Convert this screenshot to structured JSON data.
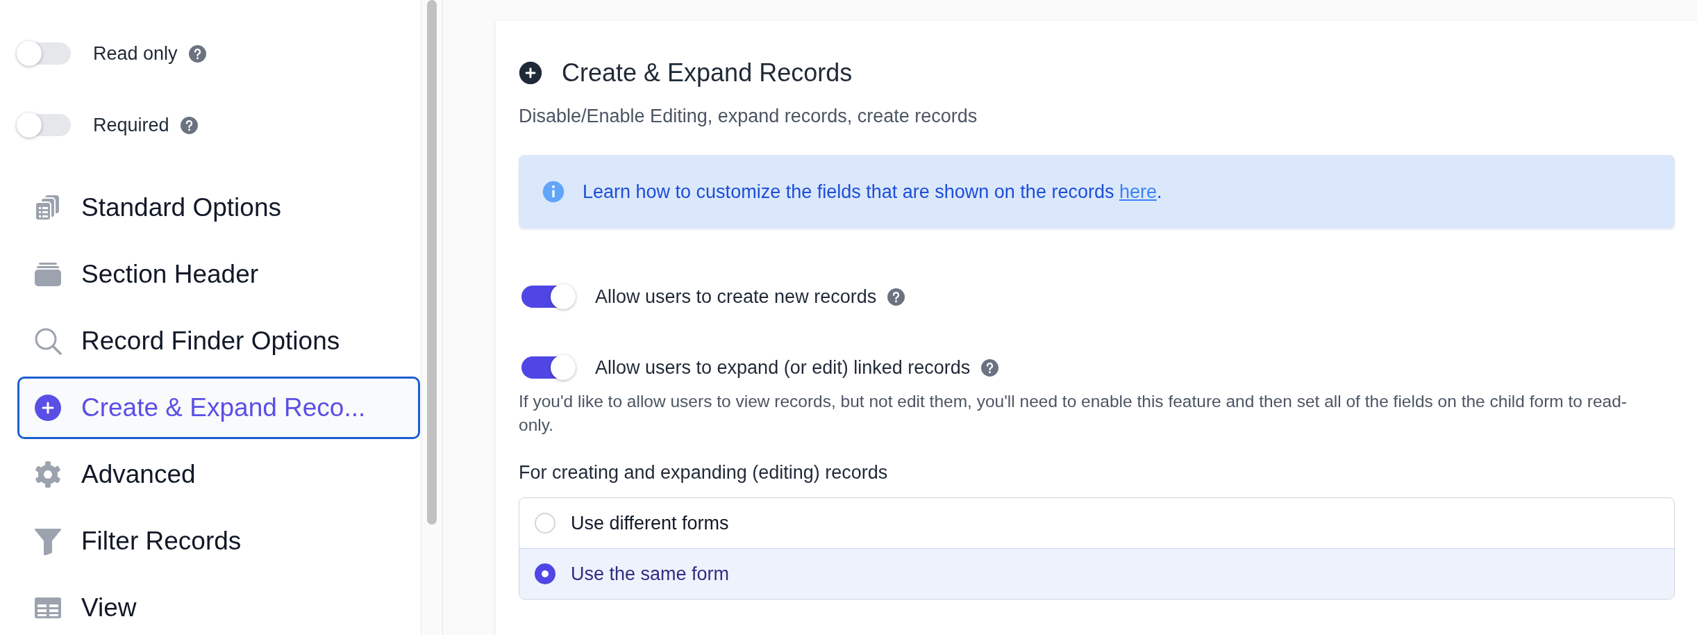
{
  "sidebar": {
    "toggles": [
      {
        "label": "Read only",
        "on": false
      },
      {
        "label": "Required",
        "on": false
      }
    ],
    "items": [
      {
        "label": "Standard Options",
        "kind": "clipboard",
        "selected": false
      },
      {
        "label": "Section Header",
        "kind": "stack",
        "selected": false
      },
      {
        "label": "Record Finder Options",
        "kind": "search",
        "selected": false
      },
      {
        "label": "Create & Expand Reco...",
        "kind": "plus",
        "selected": true
      },
      {
        "label": "Advanced",
        "kind": "gear",
        "selected": false
      },
      {
        "label": "Filter Records",
        "kind": "funnel",
        "selected": false
      },
      {
        "label": "View",
        "kind": "table",
        "selected": false
      }
    ]
  },
  "panel": {
    "title": "Create & Expand Records",
    "subtitle": "Disable/Enable Editing, expand records, create records",
    "info": {
      "text": "Learn how to customize the fields that are shown on the records ",
      "link": "here",
      "after": "."
    },
    "toggles": [
      {
        "label": "Allow users to create new records",
        "on": true
      },
      {
        "label": "Allow users to expand (or edit) linked records",
        "on": true,
        "note": "If you'd like to allow users to view records, but not edit them, you'll need to enable this feature and then set all of the fields on the child form to read-only."
      }
    ],
    "radio_group": {
      "label": "For creating and expanding (editing) records",
      "options": [
        {
          "label": "Use different forms",
          "selected": false
        },
        {
          "label": "Use the same form",
          "selected": true
        }
      ]
    }
  }
}
